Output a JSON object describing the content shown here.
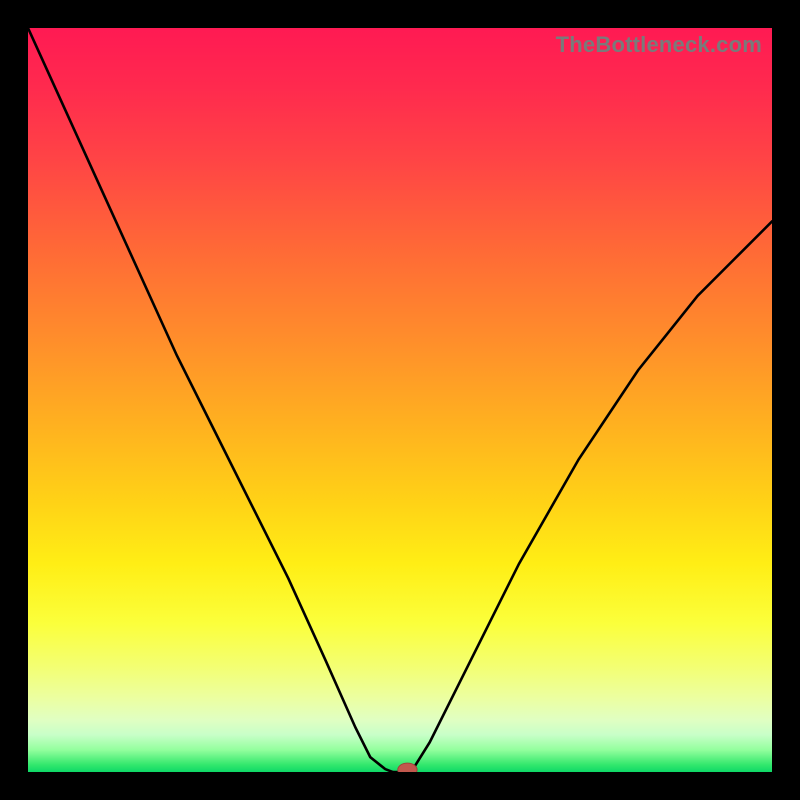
{
  "watermark": "TheBottleneck.com",
  "colors": {
    "frame": "#000000",
    "curve": "#000000",
    "marker_fill": "#c1584d",
    "marker_stroke": "#9e4238"
  },
  "chart_data": {
    "type": "line",
    "title": "",
    "xlabel": "",
    "ylabel": "",
    "xlim": [
      0,
      100
    ],
    "ylim": [
      0,
      100
    ],
    "grid": false,
    "legend": false,
    "annotations": [],
    "series": [
      {
        "name": "left-branch",
        "x": [
          0,
          5,
          10,
          15,
          20,
          25,
          30,
          35,
          40,
          44,
          46,
          48,
          49
        ],
        "y": [
          100,
          89,
          78,
          67,
          56,
          46,
          36,
          26,
          15,
          6,
          2,
          0.4,
          0
        ]
      },
      {
        "name": "flat-bottom",
        "x": [
          49,
          51.5
        ],
        "y": [
          0,
          0
        ]
      },
      {
        "name": "right-branch",
        "x": [
          51.5,
          54,
          58,
          62,
          66,
          70,
          74,
          78,
          82,
          86,
          90,
          95,
          100
        ],
        "y": [
          0,
          4,
          12,
          20,
          28,
          35,
          42,
          48,
          54,
          59,
          64,
          69,
          74
        ]
      }
    ],
    "marker": {
      "x": 51,
      "y": 0.3,
      "rx": 1.3,
      "ry": 0.9
    }
  }
}
